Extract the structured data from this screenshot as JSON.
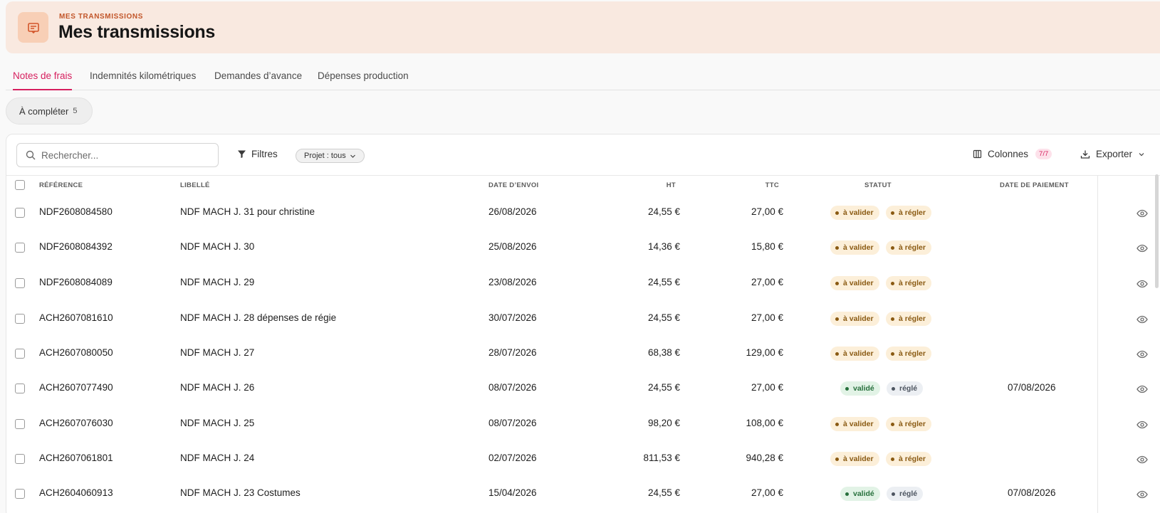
{
  "header": {
    "eyebrow": "MES TRANSMISSIONS",
    "title": "Mes transmissions",
    "icon": "receipt-icon"
  },
  "tabs": [
    {
      "label": "Notes de frais",
      "active": true
    },
    {
      "label": "Indemnités kilométriques",
      "active": false
    },
    {
      "label": "Demandes d’avance",
      "active": false
    },
    {
      "label": "Dépenses production",
      "active": false
    }
  ],
  "filter_chip": {
    "label": "À compléter",
    "count": "5"
  },
  "toolbar": {
    "search_placeholder": "Rechercher...",
    "filters_label": "Filtres",
    "projet_label": "Projet : tous",
    "colonnes_label": "Colonnes",
    "colonnes_count": "7/7",
    "export_label": "Exporter"
  },
  "columns": {
    "reference": "RÉFÉRENCE",
    "libelle": "LIBELLÉ",
    "date_envoi": "DATE D’ENVOI",
    "ht": "HT",
    "ttc": "TTC",
    "statut": "STATUT",
    "date_paiement": "DATE DE PAIEMENT"
  },
  "colors": {
    "accent": "#d61f5e",
    "header_bg": "#f9e9e0",
    "warn_bg": "#fcefd9",
    "ok_bg": "#e2f3e6"
  },
  "rows": [
    {
      "ref": "NDF2608084580",
      "libelle": "NDF MACH J. 31 pour christine",
      "date": "26/08/2026",
      "ht": "24,55 €",
      "ttc": "27,00 €",
      "status": [
        {
          "label": "à valider",
          "kind": "warn"
        },
        {
          "label": "à régler",
          "kind": "warn"
        }
      ],
      "paid": ""
    },
    {
      "ref": "NDF2608084392",
      "libelle": "NDF MACH J. 30",
      "date": "25/08/2026",
      "ht": "14,36 €",
      "ttc": "15,80 €",
      "status": [
        {
          "label": "à valider",
          "kind": "warn"
        },
        {
          "label": "à régler",
          "kind": "warn"
        }
      ],
      "paid": ""
    },
    {
      "ref": "NDF2608084089",
      "libelle": "NDF MACH J. 29",
      "date": "23/08/2026",
      "ht": "24,55 €",
      "ttc": "27,00 €",
      "status": [
        {
          "label": "à valider",
          "kind": "warn"
        },
        {
          "label": "à régler",
          "kind": "warn"
        }
      ],
      "paid": ""
    },
    {
      "ref": "ACH2607081610",
      "libelle": "NDF MACH J. 28 dépenses de régie",
      "date": "30/07/2026",
      "ht": "24,55 €",
      "ttc": "27,00 €",
      "status": [
        {
          "label": "à valider",
          "kind": "warn"
        },
        {
          "label": "à régler",
          "kind": "warn"
        }
      ],
      "paid": ""
    },
    {
      "ref": "ACH2607080050",
      "libelle": "NDF MACH J. 27",
      "date": "28/07/2026",
      "ht": "68,38 €",
      "ttc": "129,00 €",
      "status": [
        {
          "label": "à valider",
          "kind": "warn"
        },
        {
          "label": "à régler",
          "kind": "warn"
        }
      ],
      "paid": ""
    },
    {
      "ref": "ACH2607077490",
      "libelle": "NDF MACH J. 26",
      "date": "08/07/2026",
      "ht": "24,55 €",
      "ttc": "27,00 €",
      "status": [
        {
          "label": "validé",
          "kind": "ok"
        },
        {
          "label": "réglé",
          "kind": "neutral"
        }
      ],
      "paid": "07/08/2026"
    },
    {
      "ref": "ACH2607076030",
      "libelle": "NDF MACH J. 25",
      "date": "08/07/2026",
      "ht": "98,20 €",
      "ttc": "108,00 €",
      "status": [
        {
          "label": "à valider",
          "kind": "warn"
        },
        {
          "label": "à régler",
          "kind": "warn"
        }
      ],
      "paid": ""
    },
    {
      "ref": "ACH2607061801",
      "libelle": "NDF MACH J. 24",
      "date": "02/07/2026",
      "ht": "811,53 €",
      "ttc": "940,28 €",
      "status": [
        {
          "label": "à valider",
          "kind": "warn"
        },
        {
          "label": "à régler",
          "kind": "warn"
        }
      ],
      "paid": ""
    },
    {
      "ref": "ACH2604060913",
      "libelle": "NDF MACH J. 23 Costumes",
      "date": "15/04/2026",
      "ht": "24,55 €",
      "ttc": "27,00 €",
      "status": [
        {
          "label": "validé",
          "kind": "ok"
        },
        {
          "label": "réglé",
          "kind": "neutral"
        }
      ],
      "paid": "07/08/2026"
    }
  ]
}
